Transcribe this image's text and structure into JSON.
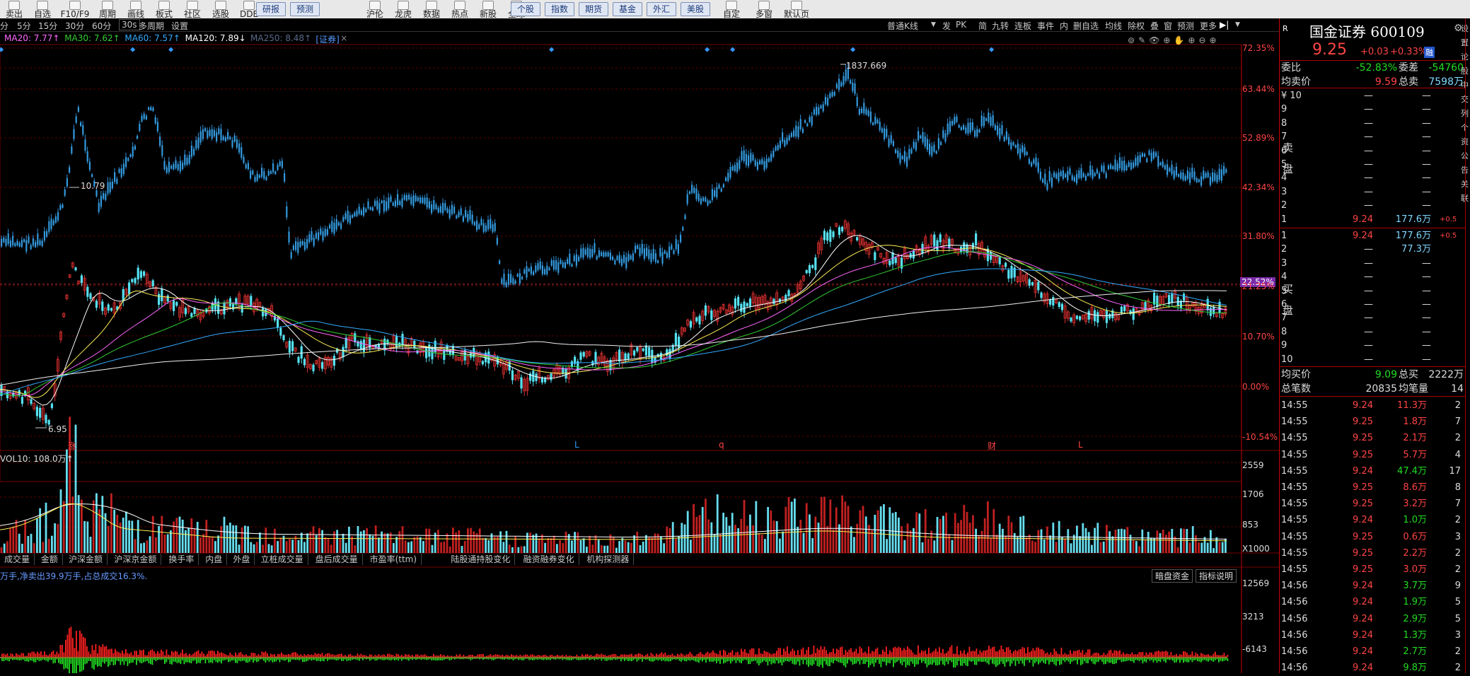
{
  "toolbar": {
    "items": [
      {
        "label": "卖出",
        "icon": "sell-icon"
      },
      {
        "label": "自选",
        "icon": "star-icon"
      },
      {
        "label": "F10/F9",
        "icon": "info-icon"
      },
      {
        "label": "周期",
        "icon": "calendar-icon"
      },
      {
        "label": "画线",
        "icon": "pen-icon"
      },
      {
        "label": "板式",
        "icon": "layout-icon"
      },
      {
        "label": "社区",
        "icon": "community-icon"
      },
      {
        "label": "选股",
        "icon": "filter-icon"
      },
      {
        "label": "DDE",
        "icon": "dde-icon"
      }
    ],
    "buttons1": [
      "研报",
      "预测"
    ],
    "items2": [
      {
        "label": "沪伦",
        "icon": "globe-icon"
      },
      {
        "label": "龙虎",
        "icon": "dragon-icon"
      },
      {
        "label": "数据",
        "icon": "data-icon"
      },
      {
        "label": "热点",
        "icon": "fire-icon"
      },
      {
        "label": "新股",
        "icon": "new-icon"
      },
      {
        "label": "全球",
        "icon": "world-icon"
      }
    ],
    "buttons2": [
      "个股",
      "指数",
      "期货",
      "基金",
      "外汇",
      "美股"
    ],
    "items3": [
      {
        "label": "自定",
        "icon": "custom-icon"
      },
      {
        "label": "多窗",
        "icon": "windows-icon"
      },
      {
        "label": "默认页",
        "icon": "home-icon"
      }
    ]
  },
  "period_bar": {
    "periods": [
      "分",
      "5分",
      "15分",
      "30分",
      "60分",
      "30s"
    ],
    "extra": [
      "多周期",
      "设置"
    ],
    "kline_type": "普通K线",
    "tools": [
      "发",
      "PK",
      "简",
      "九转",
      "连板",
      "事件",
      "内",
      "删自选",
      "均线",
      "除权",
      "叠",
      "窗",
      "预测",
      "更多"
    ]
  },
  "ma_legend": [
    {
      "label": "MA20: 7.77↑",
      "color": "#ff66ff"
    },
    {
      "label": "MA30: 7.62↑",
      "color": "#33cc33"
    },
    {
      "label": "MA60: 7.57↑",
      "color": "#33aaff"
    },
    {
      "label": "MA120: 7.89↓",
      "color": "#ffffff"
    },
    {
      "label": "MA250: 8.48↑",
      "color": "#5a6a8a"
    },
    {
      "label": "[证券]",
      "color": "#5599ff"
    }
  ],
  "price_chart": {
    "high_label": "1837.669",
    "mid_label": "10.79",
    "low_label": "6.95",
    "current_pct": "22.52%",
    "pct_axis": [
      "72.35%",
      "63.44%",
      "52.89%",
      "42.34%",
      "31.80%",
      "21.25%",
      "10.70%",
      "0.00%",
      "-10.54%"
    ],
    "event_marks": [
      {
        "t": "涨",
        "color": "#ff4444"
      },
      {
        "t": "L",
        "color": "#3399ff"
      },
      {
        "t": "q",
        "color": "#ff4444"
      },
      {
        "t": "财",
        "color": "#ff4444"
      },
      {
        "t": "L",
        "color": "#ff4444"
      }
    ]
  },
  "volume_chart": {
    "legend": "VOL10: 108.0万↑",
    "axis": [
      "2559",
      "1706",
      "853",
      "X1000"
    ]
  },
  "indicator_tabs": [
    "成交量",
    "金额",
    "沪深金额",
    "沪深京金额",
    "换手率",
    "内盘",
    "外盘",
    "立桩成交量",
    "盘后成交量",
    "市盈率(ttm)",
    "陆股通持股变化",
    "融资融券变化",
    "机构探测器"
  ],
  "fund_chart": {
    "legend": "万手,净卖出39.9万手,占总成交16.3%.",
    "buttons": [
      "暗盘资金",
      "指标说明"
    ],
    "axis": [
      "12569",
      "3213",
      "-6143"
    ]
  },
  "quote": {
    "name": "国金证券 600109",
    "r_label": "R",
    "price": "9.25",
    "change": "+0.03",
    "change_pct": "+0.33%",
    "tag": "融",
    "rows": [
      {
        "label": "委比",
        "v1": "-52.83%",
        "label2": "委差",
        "v2": "-54760"
      },
      {
        "label": "均卖价",
        "v1": "9.59",
        "label2": "总卖",
        "v2": "7598万"
      }
    ],
    "sell_label": "卖盘",
    "sell_levels": [
      {
        "lvl": "¥ 10",
        "price": "—",
        "vol": "—"
      },
      {
        "lvl": "9",
        "price": "—",
        "vol": "—"
      },
      {
        "lvl": "8",
        "price": "—",
        "vol": "—"
      },
      {
        "lvl": "7",
        "price": "—",
        "vol": "—"
      },
      {
        "lvl": "6",
        "price": "—",
        "vol": "—"
      },
      {
        "lvl": "5",
        "price": "—",
        "vol": "—"
      },
      {
        "lvl": "4",
        "price": "—",
        "vol": "—"
      },
      {
        "lvl": "3",
        "price": "—",
        "vol": "—"
      },
      {
        "lvl": "2",
        "price": "—",
        "vol": "—"
      },
      {
        "lvl": "1",
        "price": "9.24",
        "vol": "177.6万",
        "chg": "+0.5"
      }
    ],
    "buy_label": "买盘",
    "buy_levels": [
      {
        "lvl": "1",
        "price": "9.24",
        "vol": "177.6万",
        "chg": "+0.5"
      },
      {
        "lvl": "2",
        "price": "—",
        "vol": "77.3万"
      },
      {
        "lvl": "3",
        "price": "—",
        "vol": "—"
      },
      {
        "lvl": "4",
        "price": "—",
        "vol": "—"
      },
      {
        "lvl": "5",
        "price": "—",
        "vol": "—"
      },
      {
        "lvl": "6",
        "price": "—",
        "vol": "—"
      },
      {
        "lvl": "7",
        "price": "—",
        "vol": "—"
      },
      {
        "lvl": "8",
        "price": "—",
        "vol": "—"
      },
      {
        "lvl": "9",
        "price": "—",
        "vol": "—"
      },
      {
        "lvl": "10",
        "price": "—",
        "vol": "—"
      }
    ],
    "bottom_rows": [
      {
        "label": "均买价",
        "v1": "9.09",
        "label2": "总买",
        "v2": "2222万"
      },
      {
        "label": "总笔数",
        "v1": "20835",
        "label2": "均笔量",
        "v2": "14"
      }
    ],
    "side_labels": [
      "设",
      "置",
      "论",
      "股",
      "中",
      "交",
      "列",
      "个",
      "资",
      "公",
      "告",
      "关",
      "联"
    ]
  },
  "trades": [
    {
      "time": "14:55",
      "price": "9.24",
      "vol": "11.3万",
      "n": "2",
      "pc": "#ff4444",
      "vc": "#ff4444"
    },
    {
      "time": "14:55",
      "price": "9.25",
      "vol": "1.8万",
      "n": "7",
      "pc": "#ff4444",
      "vc": "#ff4444"
    },
    {
      "time": "14:55",
      "price": "9.25",
      "vol": "2.1万",
      "n": "2",
      "pc": "#ff4444",
      "vc": "#ff4444"
    },
    {
      "time": "14:55",
      "price": "9.25",
      "vol": "5.7万",
      "n": "4",
      "pc": "#ff4444",
      "vc": "#ff4444"
    },
    {
      "time": "14:55",
      "price": "9.24",
      "vol": "47.4万",
      "n": "17",
      "pc": "#ff4444",
      "vc": "#22dd22"
    },
    {
      "time": "14:55",
      "price": "9.25",
      "vol": "8.6万",
      "n": "8",
      "pc": "#ff4444",
      "vc": "#ff4444"
    },
    {
      "time": "14:55",
      "price": "9.25",
      "vol": "3.2万",
      "n": "7",
      "pc": "#ff4444",
      "vc": "#ff4444"
    },
    {
      "time": "14:55",
      "price": "9.24",
      "vol": "1.0万",
      "n": "2",
      "pc": "#ff4444",
      "vc": "#22dd22"
    },
    {
      "time": "14:55",
      "price": "9.25",
      "vol": "0.6万",
      "n": "3",
      "pc": "#ff4444",
      "vc": "#ff4444"
    },
    {
      "time": "14:55",
      "price": "9.25",
      "vol": "2.2万",
      "n": "2",
      "pc": "#ff4444",
      "vc": "#ff4444"
    },
    {
      "time": "14:55",
      "price": "9.25",
      "vol": "3.0万",
      "n": "2",
      "pc": "#ff4444",
      "vc": "#ff4444"
    },
    {
      "time": "14:56",
      "price": "9.24",
      "vol": "3.7万",
      "n": "9",
      "pc": "#ff4444",
      "vc": "#22dd22"
    },
    {
      "time": "14:56",
      "price": "9.24",
      "vol": "1.9万",
      "n": "5",
      "pc": "#ff4444",
      "vc": "#22dd22"
    },
    {
      "time": "14:56",
      "price": "9.24",
      "vol": "2.9万",
      "n": "5",
      "pc": "#ff4444",
      "vc": "#22dd22"
    },
    {
      "time": "14:56",
      "price": "9.24",
      "vol": "1.3万",
      "n": "3",
      "pc": "#ff4444",
      "vc": "#22dd22"
    },
    {
      "time": "14:56",
      "price": "9.24",
      "vol": "2.7万",
      "n": "2",
      "pc": "#ff4444",
      "vc": "#22dd22"
    },
    {
      "time": "14:56",
      "price": "9.24",
      "vol": "9.8万",
      "n": "2",
      "pc": "#ff4444",
      "vc": "#22dd22"
    }
  ],
  "colors": {
    "up": "#ff4444",
    "down": "#22dd22",
    "kline_blue": "#3399dd",
    "axis_red": "#ff4444",
    "border": "#cc0000"
  }
}
